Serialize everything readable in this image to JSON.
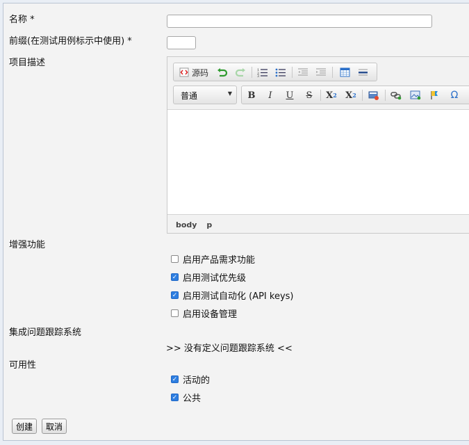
{
  "form": {
    "name_label": "名称 *",
    "prefix_label": "前缀(在测试用例标示中使用) *",
    "description_label": "项目描述",
    "enhanced_label": "增强功能",
    "issue_tracker_label": "集成问题跟踪系统",
    "issue_tracker_value": ">> 没有定义问题跟踪系统 <<",
    "availability_label": "可用性"
  },
  "editor": {
    "source_label": "源码",
    "format_select": "普通",
    "bold": "B",
    "italic": "I",
    "underline": "U",
    "strike": "S",
    "subscript_base": "X",
    "subscript_mark": "2",
    "superscript_base": "X",
    "superscript_mark": "2",
    "special_char": "Ω",
    "path": [
      "body",
      "p"
    ]
  },
  "features": [
    {
      "label": "启用产品需求功能",
      "checked": false
    },
    {
      "label": "启用测试优先级",
      "checked": true
    },
    {
      "label": "启用测试自动化 (API keys)",
      "checked": true
    },
    {
      "label": "启用设备管理",
      "checked": false
    }
  ],
  "availability": [
    {
      "label": "活动的",
      "checked": true
    },
    {
      "label": "公共",
      "checked": true
    }
  ],
  "buttons": {
    "create": "创建",
    "cancel": "取消"
  }
}
